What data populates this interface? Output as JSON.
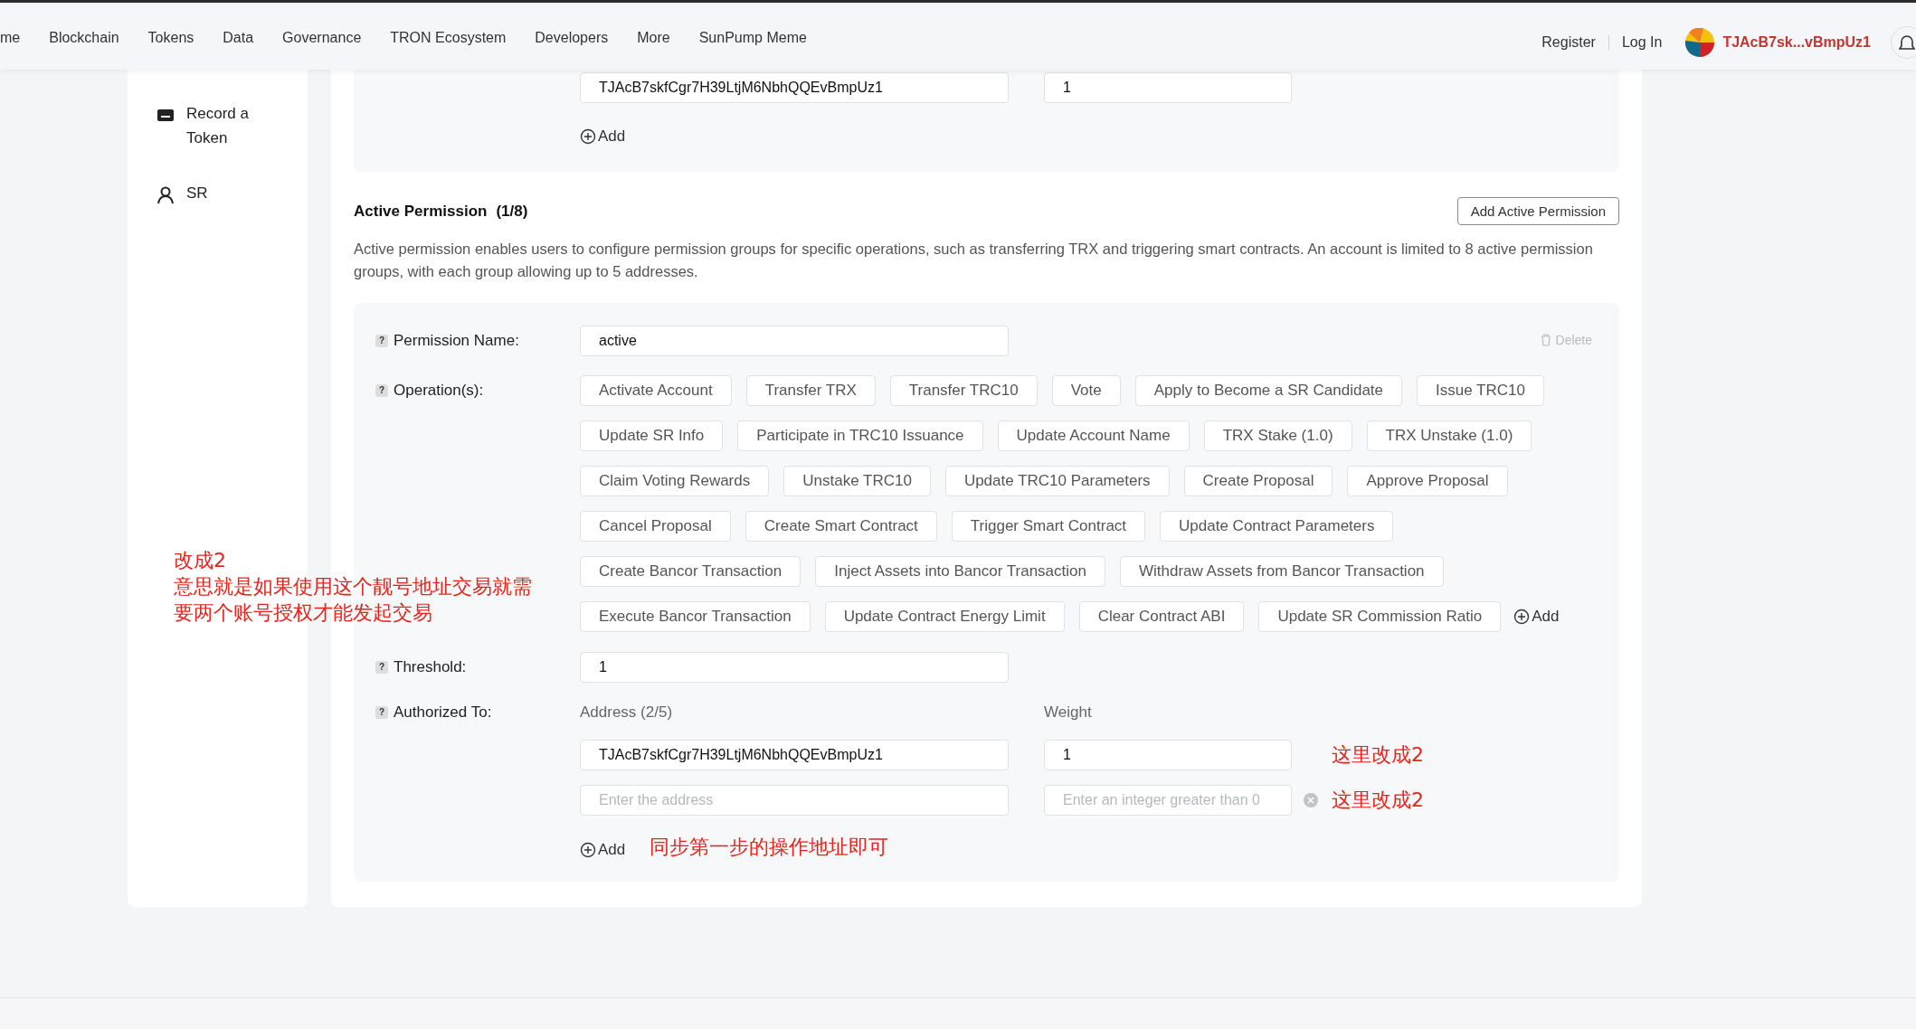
{
  "nav": {
    "items": [
      {
        "label": "me"
      },
      {
        "label": "Blockchain"
      },
      {
        "label": "Tokens"
      },
      {
        "label": "Data"
      },
      {
        "label": "Governance"
      },
      {
        "label": "TRON Ecosystem"
      },
      {
        "label": "Developers"
      },
      {
        "label": "More"
      },
      {
        "label": "SunPump Meme"
      }
    ],
    "register": "Register",
    "login": "Log In",
    "account": "TJAcB7sk...vBmpUz1"
  },
  "sidebar": {
    "items": [
      {
        "kind": "token",
        "label": "Record a Token"
      },
      {
        "kind": "sr",
        "label": "SR"
      }
    ]
  },
  "owner_section": {
    "address_value": "TJAcB7skfCgr7H39LtjM6NbhQQEvBmpUz1",
    "weight_value": "1",
    "add_label": "Add"
  },
  "active_permission": {
    "title": "Active Permission",
    "count": "(1/8)",
    "add_button": "Add Active Permission",
    "description": "Active permission enables users to configure permission groups for specific operations, such as transferring TRX and triggering smart contracts. An account is limited to 8 active permission groups, with each group allowing up to 5 addresses.",
    "help_mark": "?",
    "permission_name_label": "Permission Name:",
    "permission_name_value": "active",
    "delete_label": "Delete",
    "operations_label": "Operation(s):",
    "operation_rows": [
      [
        "Activate Account",
        "Transfer TRX",
        "Transfer TRC10",
        "Vote",
        "Apply to Become a SR Candidate",
        "Issue TRC10"
      ],
      [
        "Update SR Info",
        "Participate in TRC10 Issuance",
        "Update Account Name",
        "TRX Stake (1.0)",
        "TRX Unstake (1.0)"
      ],
      [
        "Claim Voting Rewards",
        "Unstake TRC10",
        "Update TRC10 Parameters",
        "Create Proposal",
        "Approve Proposal"
      ],
      [
        "Cancel Proposal",
        "Create Smart Contract",
        "Trigger Smart Contract",
        "Update Contract Parameters"
      ],
      [
        "Create Bancor Transaction",
        "Inject Assets into Bancor Transaction",
        "Withdraw Assets from Bancor Transaction"
      ],
      [
        "Execute Bancor Transaction",
        "Update Contract Energy Limit",
        "Clear Contract ABI",
        "Update SR Commission Ratio"
      ]
    ],
    "operations_add": "Add",
    "threshold_label": "Threshold:",
    "threshold_value": "1",
    "authorized_label": "Authorized To:",
    "address_header": "Address (2/5)",
    "weight_header": "Weight",
    "keys": [
      {
        "address": "TJAcB7skfCgr7H39LtjM6NbhQQEvBmpUz1",
        "weight": "1",
        "removable": false
      },
      {
        "address_placeholder": "Enter the address",
        "weight_placeholder": "Enter an integer greater than 0",
        "removable": true
      }
    ],
    "add_label": "Add"
  },
  "annotations": [
    {
      "text": "改成2"
    },
    {
      "text": "意思就是如果使用这个靓号地址交易就需要两个账号授权才能发起交易"
    },
    {
      "text": "这里改成2"
    },
    {
      "text": "这里改成2"
    },
    {
      "text": "同步第一步的操作地址即可"
    }
  ]
}
